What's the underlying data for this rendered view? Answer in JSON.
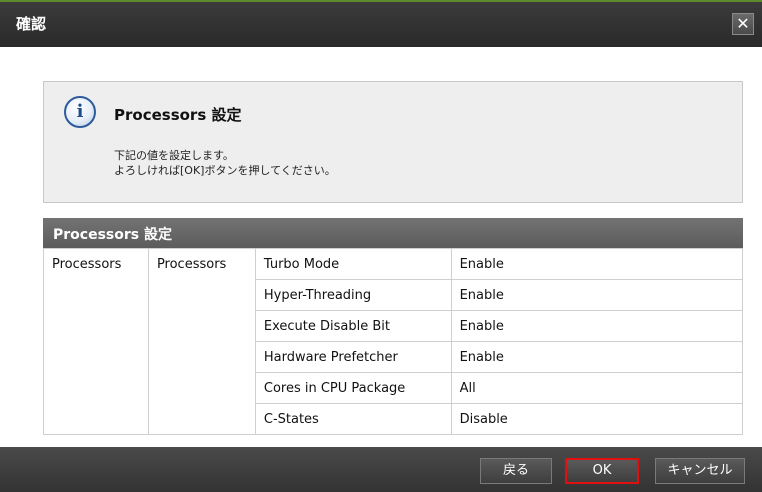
{
  "dialog": {
    "title": "確認",
    "close_label": "✕"
  },
  "info": {
    "icon": "info-icon",
    "heading": "Processors 設定",
    "message_line1": "下記の値を設定します。",
    "message_line2": "よろしければ[OK]ボタンを押してください。"
  },
  "section": {
    "header": "Processors 設定"
  },
  "table": {
    "category1": "Processors",
    "category2": "Processors",
    "rows": [
      {
        "name": "Turbo Mode",
        "value": "Enable"
      },
      {
        "name": "Hyper-Threading",
        "value": "Enable"
      },
      {
        "name": "Execute Disable Bit",
        "value": "Enable"
      },
      {
        "name": "Hardware Prefetcher",
        "value": "Enable"
      },
      {
        "name": "Cores in CPU Package",
        "value": "All"
      },
      {
        "name": "C-States",
        "value": "Disable"
      }
    ]
  },
  "buttons": {
    "back": "戻る",
    "ok": "OK",
    "cancel": "キャンセル"
  }
}
